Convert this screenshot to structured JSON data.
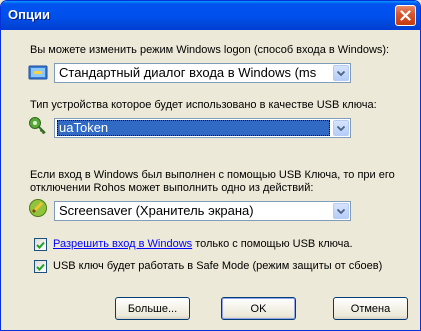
{
  "window": {
    "title": "Опции"
  },
  "logon": {
    "label": "Вы можете изменить режим Windows logon (способ входа в Windows):",
    "selected": "Стандартный диалог входа в Windows (ms"
  },
  "device": {
    "label": "Тип устройства которое будет использовано в качестве USB ключа:",
    "selected": "uaToken"
  },
  "action": {
    "label_line1": "Если вход в Windows был выполнен с помощью USB Ключа, то при его",
    "label_line2": "отключении Rohos может выполнить одно из действий:",
    "selected": "Screensaver (Хранитель экрана)"
  },
  "options": {
    "allow_link": "Разрешить вход в Windows",
    "allow_rest": " только с помощью USB ключа.",
    "allow_checked": true,
    "safemode_label": "USB ключ будет работать в Safe Mode (режим защиты от сбоев)",
    "safemode_checked": true
  },
  "buttons": {
    "more": "Больше...",
    "ok": "OK",
    "cancel": "Отмена"
  },
  "colors": {
    "titlebar": "#0053ee",
    "selection": "#316ac5",
    "link": "#0000ff",
    "dialog_bg": "#ece9d8"
  }
}
